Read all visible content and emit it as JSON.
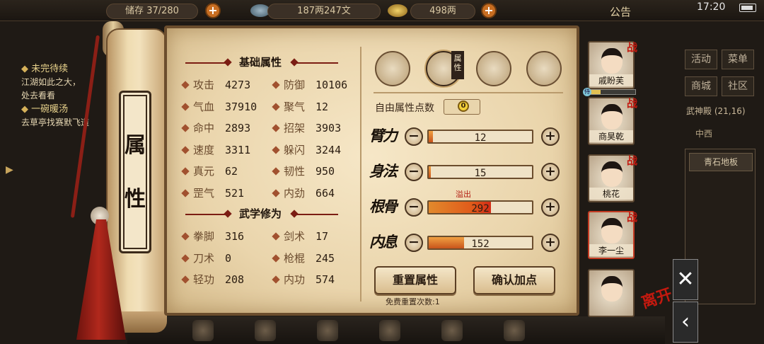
{
  "topbar": {
    "bag_label": "储存",
    "bag_value": "37/280",
    "silver_value": "187两247文",
    "gold_value": "498两",
    "notice_label": "公告",
    "clock": "17:20"
  },
  "quest": {
    "title1": "未完待续",
    "desc1a": "江湖如此之大，",
    "desc1b": "处去看看",
    "title2": "一碗暖汤",
    "desc2": "去草亭找赛默飞道"
  },
  "right_panel": {
    "buttons": [
      "活动",
      "菜单",
      "商城",
      "社区"
    ],
    "location": "武神殿",
    "coords": "(21,16)",
    "area": "中西",
    "item": "青石地板"
  },
  "scroll": {
    "title_chars": [
      "属",
      "性"
    ]
  },
  "basic": {
    "header": "基础属性",
    "stats": [
      {
        "name": "攻击",
        "value": "4273"
      },
      {
        "name": "防御",
        "value": "10106"
      },
      {
        "name": "气血",
        "value": "37910"
      },
      {
        "name": "聚气",
        "value": "12"
      },
      {
        "name": "命中",
        "value": "2893"
      },
      {
        "name": "招架",
        "value": "3903"
      },
      {
        "name": "速度",
        "value": "3311"
      },
      {
        "name": "躲闪",
        "value": "3244"
      },
      {
        "name": "真元",
        "value": "62"
      },
      {
        "name": "韧性",
        "value": "950"
      },
      {
        "name": "罡气",
        "value": "521"
      },
      {
        "name": "内劲",
        "value": "664"
      }
    ]
  },
  "martial": {
    "header": "武学修为",
    "stats": [
      {
        "name": "拳脚",
        "value": "316"
      },
      {
        "name": "剑术",
        "value": "17"
      },
      {
        "name": "刀术",
        "value": "0"
      },
      {
        "name": "枪棍",
        "value": "245"
      },
      {
        "name": "轻功",
        "value": "208"
      },
      {
        "name": "内功",
        "value": "574"
      }
    ]
  },
  "tabs": {
    "active_label": "属性"
  },
  "alloc": {
    "free_label": "自由属性点数",
    "free_value": "0",
    "overflow_label": "溢出",
    "attrs": [
      {
        "name": "臂力",
        "value": "12",
        "fill": 0.04,
        "over": false
      },
      {
        "name": "身法",
        "value": "15",
        "fill": 0.02,
        "over": false
      },
      {
        "name": "根骨",
        "value": "292",
        "fill": 0.6,
        "over": true
      },
      {
        "name": "内息",
        "value": "152",
        "fill": 0.34,
        "over": false
      }
    ],
    "reset_label": "重置属性",
    "confirm_label": "确认加点",
    "free_reset_text": "免费重置次数:1"
  },
  "party": [
    {
      "name": "戚盼芙",
      "battle": "战"
    },
    {
      "name": "商昊乾",
      "battle": "战"
    },
    {
      "name": "桃花",
      "battle": "战"
    },
    {
      "name": "李一尘",
      "battle": "战"
    },
    {
      "name": "",
      "battle": ""
    }
  ],
  "helper_tag": "侍",
  "leave_label": "离开",
  "sys": {
    "close": "✕",
    "back": "‹"
  }
}
